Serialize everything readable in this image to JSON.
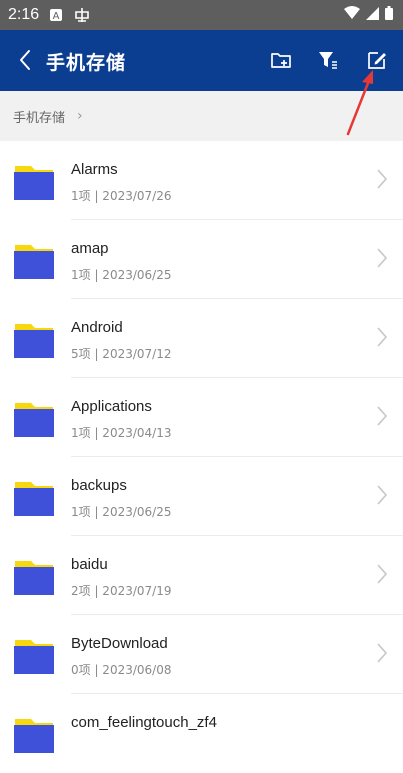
{
  "status_bar": {
    "time": "2:16"
  },
  "header": {
    "title": "手机存储"
  },
  "breadcrumb": {
    "path": "手机存储"
  },
  "files": [
    {
      "name": "Alarms",
      "meta": "1项 | 2023/07/26"
    },
    {
      "name": "amap",
      "meta": "1项 | 2023/06/25"
    },
    {
      "name": "Android",
      "meta": "5项 | 2023/07/12"
    },
    {
      "name": "Applications",
      "meta": "1项 | 2023/04/13"
    },
    {
      "name": "backups",
      "meta": "1项 | 2023/06/25"
    },
    {
      "name": "baidu",
      "meta": "2项 | 2023/07/19"
    },
    {
      "name": "ByteDownload",
      "meta": "0项 | 2023/06/08"
    },
    {
      "name": "com_feelingtouch_zf4",
      "meta": ""
    }
  ],
  "colors": {
    "header_bg": "#0b3d91",
    "folder_blue": "#3f51d8",
    "folder_yellow": "#f7d80e",
    "annotation": "#e53935"
  },
  "icons": [
    "back-icon",
    "new-folder-icon",
    "filter-icon",
    "edit-icon",
    "folder-icon",
    "chevron-right-icon"
  ]
}
